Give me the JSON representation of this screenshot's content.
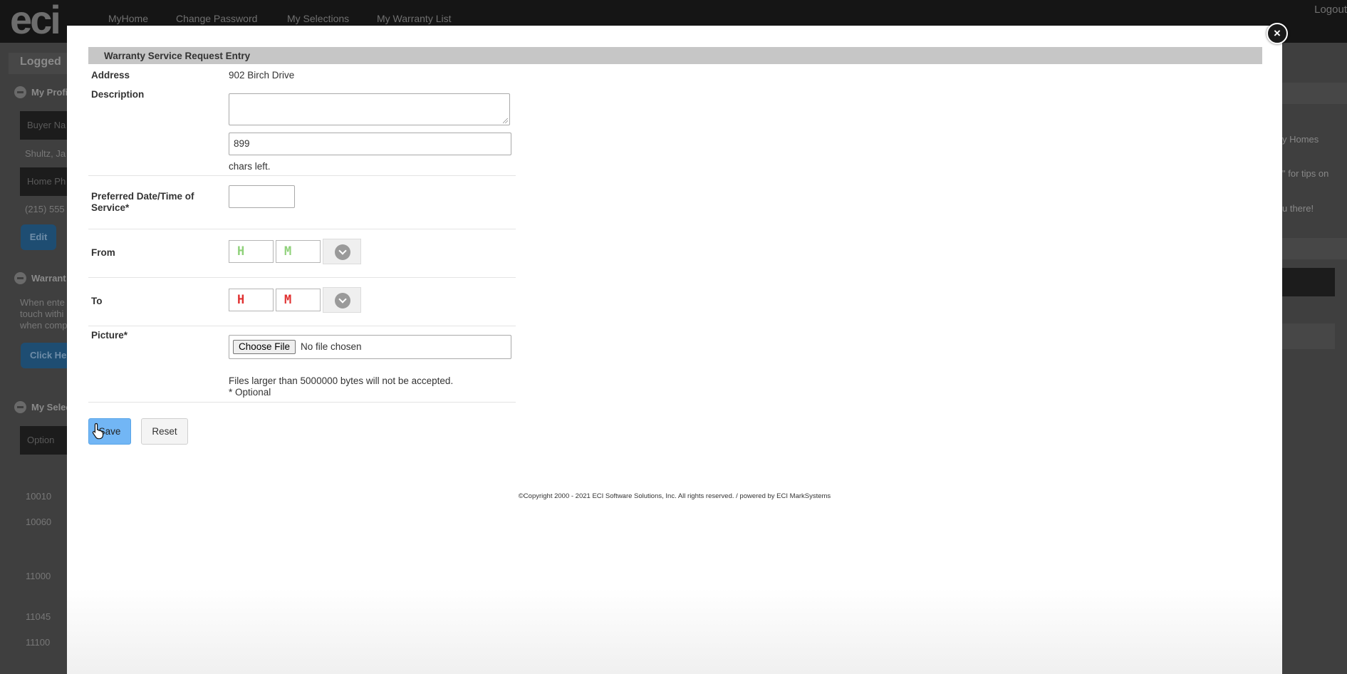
{
  "header": {
    "logo": "eci",
    "nav": [
      "MyHome",
      "Change Password",
      "My Selections",
      "My Warranty List"
    ],
    "logout": "Logout"
  },
  "background": {
    "logged_label": "Logged",
    "profile_title": "My Profi",
    "buyer_label": "Buyer Na",
    "buyer_name": "Shultz, Ja",
    "home_label": "Home Ph",
    "phone": "(215) 555",
    "edit_button": "Edit",
    "warranty_title": "Warrant",
    "warranty_text": [
      "When ente",
      "touch withi",
      "when comp"
    ],
    "click_button": "Click He",
    "selections_title": "My Selec",
    "option_header": "Option",
    "options": [
      "10010",
      "10060",
      "11000",
      "11045",
      "11100"
    ],
    "right_texts": [
      "y Homes",
      "\" for tips on",
      "u there!"
    ]
  },
  "modal": {
    "title": "Warranty Service Request Entry",
    "close_label": "×",
    "address_label": "Address",
    "address_value": "902 Birch Drive",
    "description_label": "Description",
    "chars_count": "899",
    "chars_left": "chars left.",
    "preferred_label": "Preferred Date/Time of Service*",
    "from_label": "From",
    "to_label": "To",
    "hour_placeholder": "H",
    "minute_placeholder": "M",
    "picture_label": "Picture*",
    "choose_file": "Choose File",
    "no_file": "No file chosen",
    "file_note": "Files larger than 5000000 bytes will not be accepted.",
    "optional_note": "* Optional",
    "save_button": "Save",
    "reset_button": "Reset",
    "footer": "©Copyright 2000 - 2021 ECI Software Solutions, Inc. All rights reserved. / powered by ECI MarkSystems"
  },
  "colors": {
    "save_button_bg": "#72b6f5",
    "time_from_color": "#8fd17a",
    "time_to_color": "#e03131",
    "panel_header_bg": "#c6c6c6"
  }
}
